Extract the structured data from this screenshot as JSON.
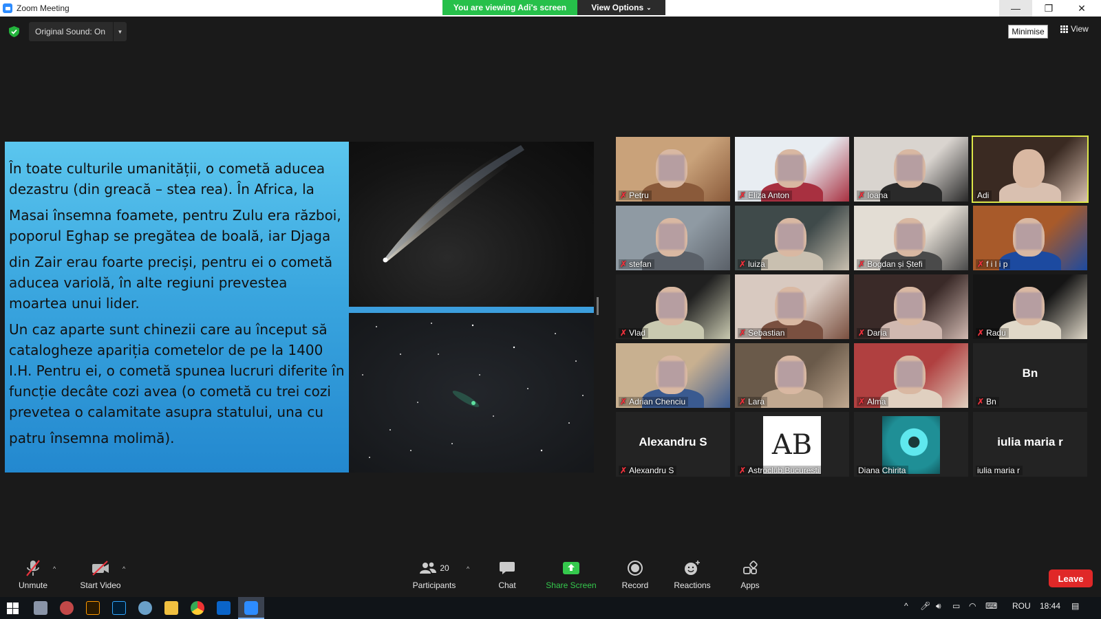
{
  "window": {
    "title": "Zoom Meeting",
    "viewing_banner": "You are viewing Adi's screen",
    "view_options": "View Options"
  },
  "top_bar": {
    "original_sound": "Original Sound: On",
    "minimise": "Minimise",
    "view": "View"
  },
  "slide": {
    "paragraphs": [
      "În toate culturile umanității, o cometă aducea dezastru (din greacă – stea rea). În Africa, la",
      "Masai însemna foamete, pentru Zulu era război, poporul Eghap se pregătea de boală, iar Djaga",
      "din Zair erau foarte preciși, pentru ei o cometă aducea variolă, în alte regiuni prevestea moartea unui lider.",
      "Un caz aparte sunt chinezii care au început să catalogheze apariția cometelor de pe la 1400 I.H. Pentru ei, o cometă spunea lucruri diferite în funcție decâte cozi avea (o cometă cu trei cozi prevetea o calamitate asupra statului, una cu",
      "patru însemna molimă)."
    ]
  },
  "participants": [
    {
      "name": "Petru",
      "muted": true,
      "active": false
    },
    {
      "name": "Eliza Anton",
      "muted": true,
      "active": false
    },
    {
      "name": "Ioana",
      "muted": true,
      "active": false
    },
    {
      "name": "Adi",
      "muted": false,
      "active": true
    },
    {
      "name": "stefan",
      "muted": true,
      "active": false
    },
    {
      "name": "luiza",
      "muted": true,
      "active": false
    },
    {
      "name": "Bogdan și Ștefi",
      "muted": true,
      "active": false
    },
    {
      "name": "f i l i p",
      "muted": true,
      "active": false
    },
    {
      "name": "Vlad",
      "muted": true,
      "active": false
    },
    {
      "name": "Sebastian",
      "muted": true,
      "active": false
    },
    {
      "name": "Daria",
      "muted": true,
      "active": false
    },
    {
      "name": "Radu",
      "muted": true,
      "active": false
    },
    {
      "name": "Adrian Chenciu",
      "muted": true,
      "active": false
    },
    {
      "name": "Lara",
      "muted": true,
      "active": false
    },
    {
      "name": "Alma",
      "muted": true,
      "active": false
    },
    {
      "name": "Bn",
      "muted": true,
      "active": false,
      "big_name": "Bn"
    },
    {
      "name": "Alexandru S",
      "muted": true,
      "active": false,
      "big_name": "Alexandru S"
    },
    {
      "name": "Astroclub Bucuresti",
      "muted": true,
      "active": false
    },
    {
      "name": "Diana Chirita",
      "muted": false,
      "active": false
    },
    {
      "name": "iulia maria r",
      "muted": false,
      "active": false,
      "big_name": "iulia maria r"
    }
  ],
  "toolbar": {
    "unmute": "Unmute",
    "start_video": "Start Video",
    "participants_count": "20",
    "participants": "Participants",
    "chat": "Chat",
    "share_screen": "Share Screen",
    "record": "Record",
    "reactions": "Reactions",
    "apps": "Apps",
    "leave": "Leave"
  },
  "taskbar": {
    "language": "ROU",
    "time": "18:44"
  },
  "colors": {
    "share_green": "#35c94d",
    "leave_red": "#e02828",
    "active_speaker": "#dde649",
    "muted_red": "#e8323c"
  }
}
